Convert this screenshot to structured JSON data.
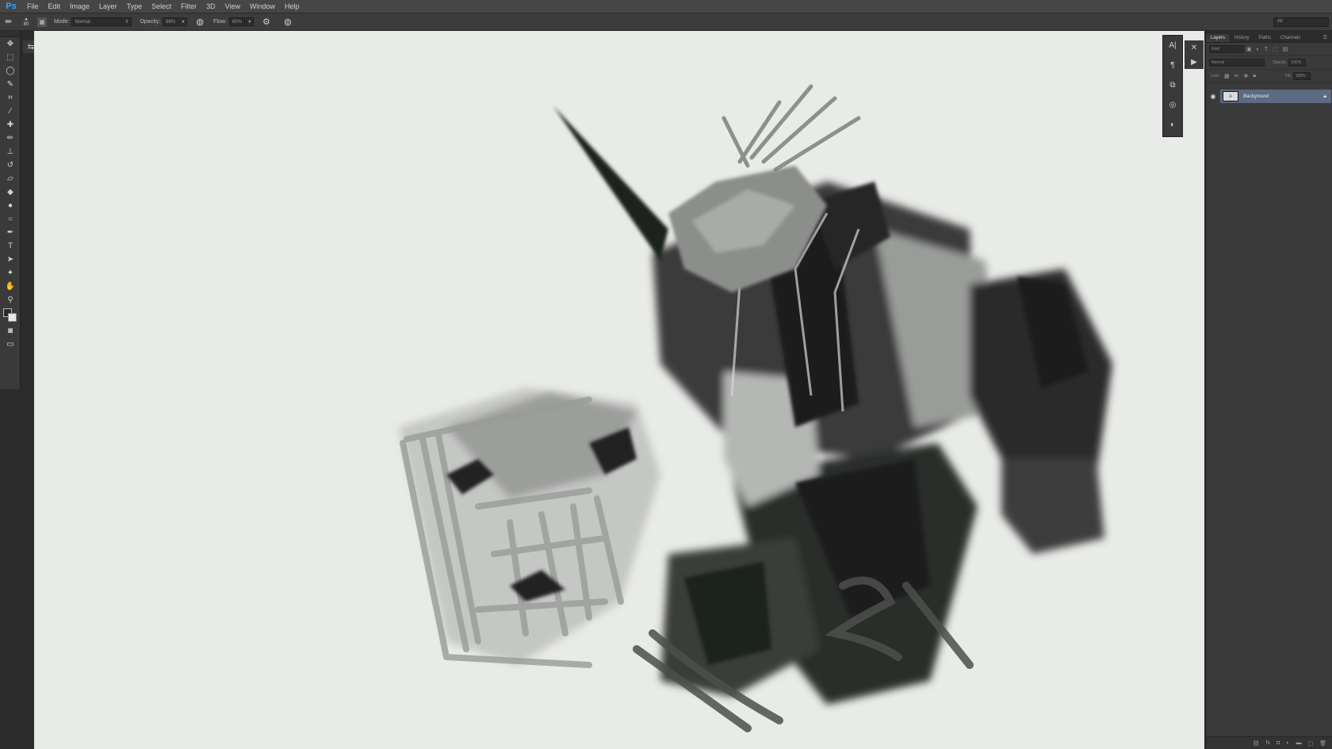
{
  "app": {
    "logo": "Ps"
  },
  "menu": [
    "File",
    "Edit",
    "Image",
    "Layer",
    "Type",
    "Select",
    "Filter",
    "3D",
    "View",
    "Window",
    "Help"
  ],
  "options": {
    "brush_size": "80",
    "mode_label": "Mode:",
    "mode_value": "Normal",
    "opacity_label": "Opacity:",
    "opacity_value": "98%",
    "flow_label": "Flow:",
    "flow_value": "60%",
    "workspace": "All"
  },
  "tools": [
    {
      "name": "move-tool",
      "icon": "move-icon",
      "glyph": "✥"
    },
    {
      "name": "marquee-tool",
      "icon": "marquee-icon",
      "glyph": "⬚"
    },
    {
      "name": "lasso-tool",
      "icon": "lasso-icon",
      "glyph": "◯"
    },
    {
      "name": "quick-select-tool",
      "icon": "magic-wand-icon",
      "glyph": "✎"
    },
    {
      "name": "crop-tool",
      "icon": "crop-icon",
      "glyph": "⌗"
    },
    {
      "name": "eyedropper-tool",
      "icon": "eyedropper-icon",
      "glyph": "⁄"
    },
    {
      "name": "healing-tool",
      "icon": "bandage-icon",
      "glyph": "✚"
    },
    {
      "name": "brush-tool",
      "icon": "brush-icon",
      "glyph": "✏"
    },
    {
      "name": "stamp-tool",
      "icon": "stamp-icon",
      "glyph": "⊥"
    },
    {
      "name": "history-brush-tool",
      "icon": "history-brush-icon",
      "glyph": "↺"
    },
    {
      "name": "eraser-tool",
      "icon": "eraser-icon",
      "glyph": "▱"
    },
    {
      "name": "paint-bucket-tool",
      "icon": "bucket-icon",
      "glyph": "◆"
    },
    {
      "name": "blur-tool",
      "icon": "drop-icon",
      "glyph": "●"
    },
    {
      "name": "dodge-tool",
      "icon": "dodge-icon",
      "glyph": "○"
    },
    {
      "name": "pen-tool",
      "icon": "pen-icon",
      "glyph": "✒"
    },
    {
      "name": "type-tool",
      "icon": "type-icon",
      "glyph": "T"
    },
    {
      "name": "path-select-tool",
      "icon": "arrow-icon",
      "glyph": "➤"
    },
    {
      "name": "shape-tool",
      "icon": "shape-icon",
      "glyph": "✦"
    },
    {
      "name": "hand-tool",
      "icon": "hand-icon",
      "glyph": "✋"
    },
    {
      "name": "zoom-tool",
      "icon": "zoom-icon",
      "glyph": "⚲"
    }
  ],
  "layers_panel": {
    "tabs": [
      "Layers",
      "History",
      "Paths",
      "Channels"
    ],
    "filter_kind": "Kind",
    "blend_mode": "Normal",
    "opacity_label": "Opacity:",
    "opacity_value": "100%",
    "lock_label": "Lock:",
    "fill_label": "Fill:",
    "fill_value": "100%",
    "layers": [
      {
        "name": "Background",
        "visible": true,
        "locked": true,
        "selected": true
      }
    ]
  },
  "colors": {
    "canvas": "#e9ebe8",
    "ui_dark": "#3a3a3a",
    "selected_layer": "#5d6a84",
    "logo": "#30a8ff"
  }
}
